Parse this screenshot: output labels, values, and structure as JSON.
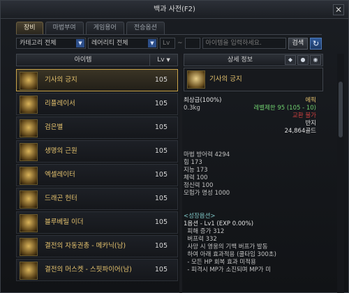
{
  "window": {
    "title": "백과 사전(F2)",
    "close_label": "✕"
  },
  "tabs": [
    {
      "label": "장비",
      "active": true
    },
    {
      "label": "마법부여",
      "active": false
    },
    {
      "label": "게임용어",
      "active": false
    },
    {
      "label": "전승옵션",
      "active": false
    }
  ],
  "filters": {
    "category": "카테고리 전체",
    "rarity": "레어리티 전체",
    "lv_min_placeholder": "Lv",
    "tilde": "~",
    "search_placeholder": "아이템을 입력하세요.",
    "search_label": "검색",
    "refresh_icon": "↻"
  },
  "list": {
    "header_item": "아이템",
    "header_lv": "Lv",
    "header_lv_arrow": "▼",
    "items": [
      {
        "name": "기사의 긍지",
        "lv": "105",
        "selected": true
      },
      {
        "name": "리플레이서",
        "lv": "105",
        "selected": false
      },
      {
        "name": "검은별",
        "lv": "105",
        "selected": false
      },
      {
        "name": "생명의 근원",
        "lv": "105",
        "selected": false
      },
      {
        "name": "엑셀레이터",
        "lv": "105",
        "selected": false
      },
      {
        "name": "드래곤 헌터",
        "lv": "105",
        "selected": false
      },
      {
        "name": "블루베릴 이더",
        "lv": "105",
        "selected": false
      },
      {
        "name": "결전의 자동권총 - 메카닉(남)",
        "lv": "105",
        "selected": false
      },
      {
        "name": "결전의 머스켓 - 스핏파이어(남)",
        "lv": "105",
        "selected": false
      }
    ]
  },
  "detail": {
    "header": "상세 정보",
    "item_name": "기사의 긍지",
    "grade": "최상급(100%)",
    "rarity": "에픽",
    "weight": "0.3kg",
    "level_limit": "레벨제한 95 (105 - 10)",
    "trade": "교환 불가",
    "type": "반지",
    "price": "24,864골드",
    "stats": [
      "마법 방어력 4294",
      "힘 173",
      "지능 173",
      "체력 100",
      "정신력 100",
      "모험가 명성 1000"
    ],
    "growth_title": "<성장옵션>",
    "growth_lines": [
      "1옵션 - Lv1 (EXP 0.00%)",
      "  피해 증가 312",
      "  버프력 332",
      "  사망 시 영웅의 기백 버프가 발동",
      "  하여 아래 효과적용 (쿨타임 300초)",
      "  - 모든 HP 회복 효과 미적용",
      "  - 피격시 MP가 소진되며 MP가 미"
    ]
  }
}
